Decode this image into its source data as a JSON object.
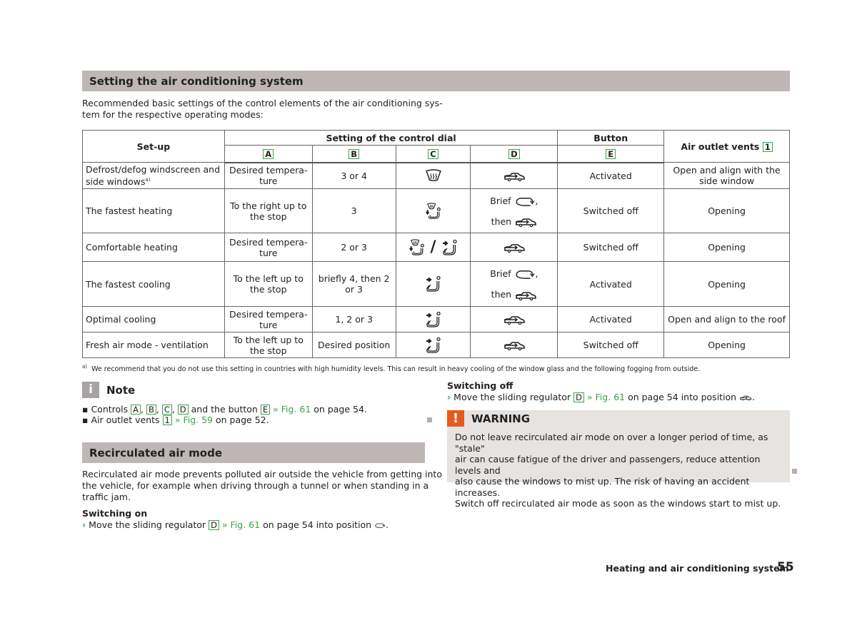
{
  "section1": {
    "title": "Setting the air conditioning system",
    "intro_line1": "Recommended basic settings of the control elements of the air conditioning sys-",
    "intro_line2": "tem for the respective operating modes:"
  },
  "table": {
    "headers": {
      "setup": "Set-up",
      "control_dial": "Setting of the control dial",
      "button": "Button",
      "vents": "Air outlet vents",
      "vents_tag": "1",
      "letters": [
        "A",
        "B",
        "C",
        "D",
        "E"
      ]
    },
    "rows": [
      {
        "setup": "Defrost/defog windscreen and side windows",
        "setup_sup": "a)",
        "a": "Desired tempera-ture",
        "b": "3 or 4",
        "c_icon": "windscreen-defrost-icon",
        "d_icon": "fresh-air-icon",
        "e": "Activated",
        "vents": "Open and align with the side window"
      },
      {
        "setup": "The fastest heating",
        "a": "To the right up to the stop",
        "b": "3",
        "c_icon": "windscreen-footwell-icon",
        "d_brief": "Brief",
        "d_then": "then",
        "e": "Switched off",
        "vents": "Opening"
      },
      {
        "setup": "Comfortable heating",
        "a": "Desired tempera-ture",
        "b": "2 or 3",
        "c_icon": "windscreen-footwell-or-body-icon",
        "c_sep": "/",
        "d_icon": "fresh-air-icon",
        "e": "Switched off",
        "vents": "Opening"
      },
      {
        "setup": "The fastest cooling",
        "a": "To the left up to the stop",
        "b": "briefly 4, then 2 or 3",
        "c_icon": "upper-body-icon",
        "d_brief": "Brief",
        "d_then": "then",
        "e": "Activated",
        "vents": "Opening"
      },
      {
        "setup": "Optimal cooling",
        "a": "Desired tempera-ture",
        "b": "1, 2 or 3",
        "c_icon": "upper-body-icon",
        "d_icon": "fresh-air-icon",
        "e": "Activated",
        "vents": "Open and align to the roof"
      },
      {
        "setup": "Fresh air mode - ventilation",
        "a": "To the left up to the stop",
        "b": "Desired position",
        "c_icon": "upper-body-icon",
        "d_icon": "fresh-air-icon",
        "e": "Switched off",
        "vents": "Opening"
      }
    ]
  },
  "footnote": {
    "marker": "a)",
    "text": "We recommend that you do not use this setting in countries with high humidity levels. This can result in heavy cooling of the window glass and the following fogging from outside."
  },
  "note": {
    "icon": "i",
    "title": "Note",
    "bullet1": {
      "prefix": "Controls",
      "tags": [
        "A",
        "B",
        "C",
        "D"
      ],
      "mid": "and the button",
      "tag_e": "E",
      "link": "» Fig. 61",
      "suffix": "on page 54."
    },
    "bullet2": {
      "prefix": "Air outlet vents",
      "tag": "1",
      "link": "» Fig. 59",
      "suffix": "on page 52."
    }
  },
  "section2": {
    "title": "Recirculated air mode",
    "body_line1": "Recirculated air mode prevents polluted air outside the vehicle from getting into",
    "body_line2": "the vehicle, for example when driving through a tunnel or when standing in a",
    "body_line3": "traffic jam.",
    "switch_on": {
      "heading": "Switching on",
      "prefix": "Move the sliding regulator",
      "tag": "D",
      "link": "» Fig. 61",
      "suffix": "on page 54 into position",
      "end": "."
    },
    "switch_off": {
      "heading": "Switching off",
      "prefix": "Move the sliding regulator",
      "tag": "D",
      "link": "» Fig. 61",
      "suffix": "on page 54 into position",
      "end": "."
    }
  },
  "warning": {
    "icon": "!",
    "title": "WARNING",
    "lines": [
      "Do not leave recirculated air mode on over a longer period of time, as \"stale\"",
      "air can cause fatigue of the driver and passengers, reduce attention levels and",
      "also cause the windows to mist up. The risk of having an accident increases.",
      "Switch off recirculated air mode as soon as the windows start to mist up."
    ]
  },
  "footer": {
    "chapter": "Heating and air conditioning system",
    "page": "55"
  },
  "colors": {
    "section_bar": "#bfb6b6",
    "tag_border": "#3aa34a",
    "link": "#3aa34a",
    "warning_icon": "#e85a1c",
    "warning_bg": "#e6e3e0",
    "note_icon": "#a8a2a2"
  }
}
